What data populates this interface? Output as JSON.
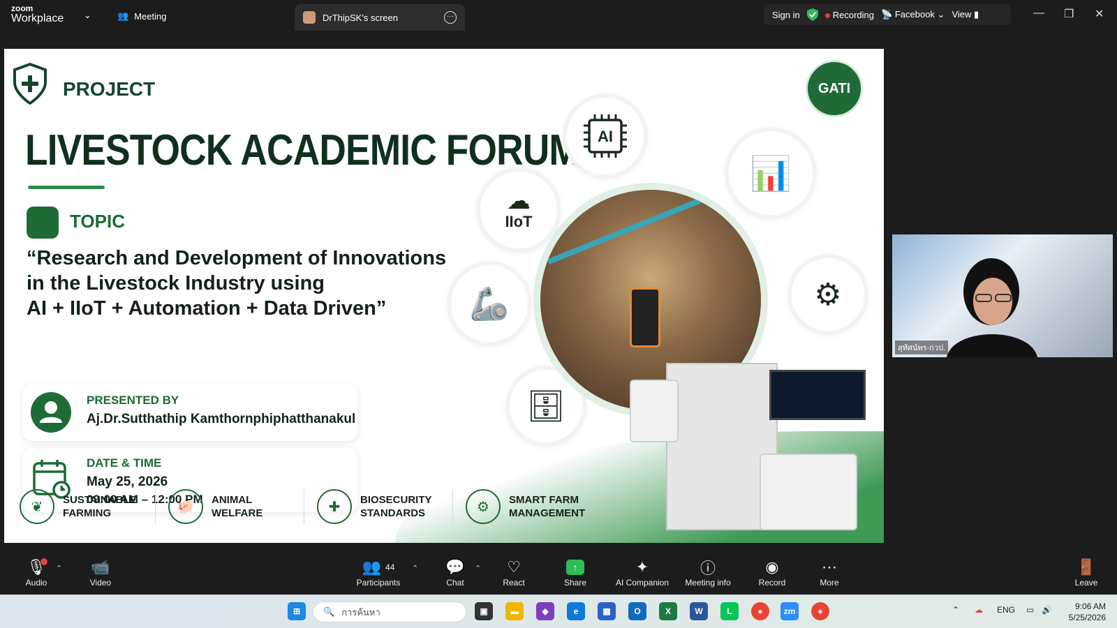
{
  "app": {
    "brand_line1": "zoom",
    "brand_line2": "Workplace"
  },
  "tabs": {
    "meeting": "Meeting",
    "screen": "DrThipSK's screen"
  },
  "status": {
    "sign_in": "Sign in",
    "recording": "Recording",
    "stream": "Facebook",
    "view": "View"
  },
  "slide": {
    "project": "PROJECT",
    "title": "LIVESTOCK ACADEMIC FORUM",
    "topic_label": "TOPIC",
    "quote_line1": "“Research and Development of Innovations",
    "quote_line2": "in the Livestock Industry using",
    "quote_line3": "AI + IIoT + Automation + Data Driven”",
    "presented_by": "PRESENTED BY",
    "presenter": "Aj.Dr.Sutthathip Kamthornphiphatthanakul",
    "date_label": "DATE & TIME",
    "date": "May 25, 2026",
    "time": "09:00 AM – 12:00 PM",
    "logo": "GATI",
    "ai_text": "AI",
    "iiot_text": "IIoT",
    "footer": [
      {
        "text": "SUSTAINABLE\nFARMING",
        "icon": "leaf-icon"
      },
      {
        "text": "ANIMAL\nWELFARE",
        "icon": "pig-icon"
      },
      {
        "text": "BIOSECURITY\nSTANDARDS",
        "icon": "shield-plus-icon"
      },
      {
        "text": "SMART FARM\nMANAGEMENT",
        "icon": "gear-icon"
      }
    ]
  },
  "participant_video": {
    "name": "สุทัศน์พร-กวป."
  },
  "toolbar": {
    "audio": "Audio",
    "video": "Video",
    "participants": "Participants",
    "participant_count": "44",
    "chat": "Chat",
    "react": "React",
    "share": "Share",
    "ai_companion": "AI Companion",
    "meeting_info": "Meeting info",
    "record": "Record",
    "more": "More",
    "leave": "Leave"
  },
  "taskbar": {
    "search_placeholder": "การค้นหา",
    "lang": "ENG",
    "time": "9:06 AM",
    "date": "5/25/2026"
  },
  "colors": {
    "brand_green": "#1d6a35",
    "share_green": "#2ebd59",
    "record_red": "#e0423c"
  }
}
